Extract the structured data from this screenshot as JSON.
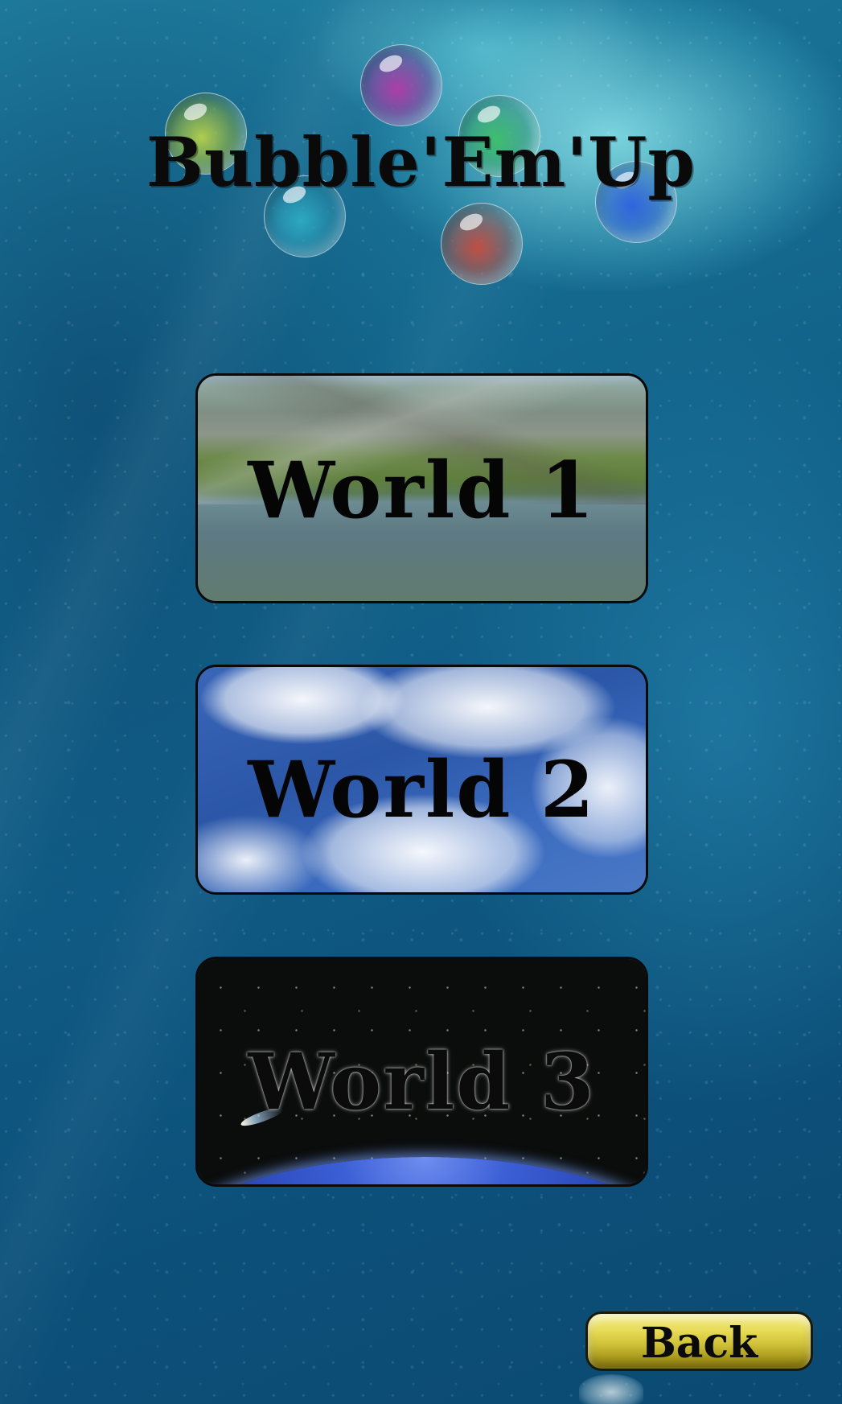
{
  "title": "Bubble'Em'Up",
  "bubble_colors": [
    "#b7d24a",
    "#b23aa8",
    "#3fbf6a",
    "#2fb0c8",
    "#d04a3a",
    "#3060e0"
  ],
  "worlds": [
    {
      "label": "World 1",
      "theme": "mountain-lake"
    },
    {
      "label": "World 2",
      "theme": "sky-clouds"
    },
    {
      "label": "World 3",
      "theme": "space-earth"
    }
  ],
  "back_label": "Back"
}
